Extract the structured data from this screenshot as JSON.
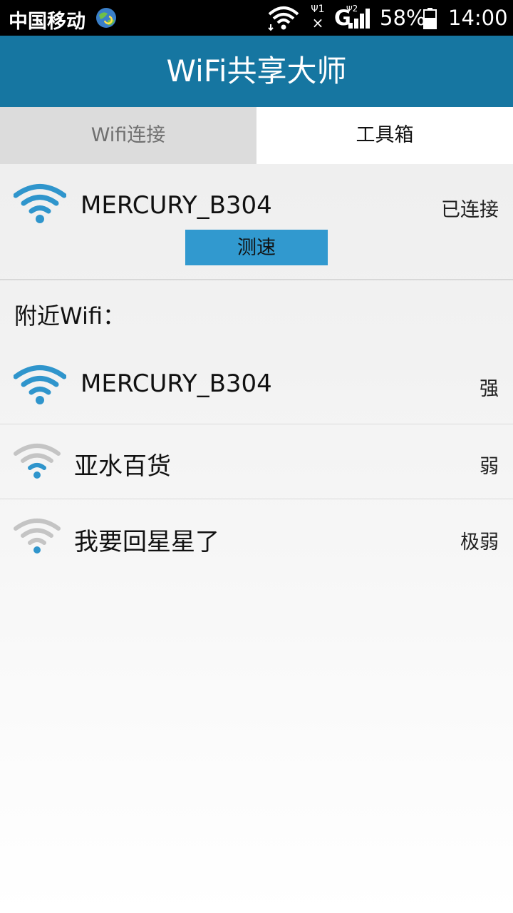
{
  "status_bar": {
    "carrier": "中国移动",
    "sim1": "1",
    "sim2": "2",
    "network": "G",
    "battery": "58%",
    "time": "14:00",
    "icons": [
      "globe-sync-icon",
      "wifi-signal-icon",
      "sim1-no-signal-icon",
      "sim2-signal-icon",
      "battery-icon"
    ]
  },
  "app_bar": {
    "title": "WiFi共享大师"
  },
  "tabs": [
    {
      "label": "Wifi连接",
      "active": false
    },
    {
      "label": "工具箱",
      "active": true
    }
  ],
  "connected": {
    "ssid": "MERCURY_B304",
    "status": "已连接",
    "speed_button": "测速",
    "icon": "wifi-strong-icon"
  },
  "nearby": {
    "label": "附近Wifi：",
    "items": [
      {
        "ssid": "MERCURY_B304",
        "strength": "强",
        "icon": "wifi-strong-icon"
      },
      {
        "ssid": "亚水百货",
        "strength": "弱",
        "icon": "wifi-weak-icon"
      },
      {
        "ssid": "我要回星星了",
        "strength": "极弱",
        "icon": "wifi-weak-icon"
      }
    ]
  },
  "colors": {
    "app_bar": "#1676a1",
    "wifi_blue": "#2f95cc",
    "wifi_gray": "#c4c4c4",
    "button": "#3199cf"
  }
}
